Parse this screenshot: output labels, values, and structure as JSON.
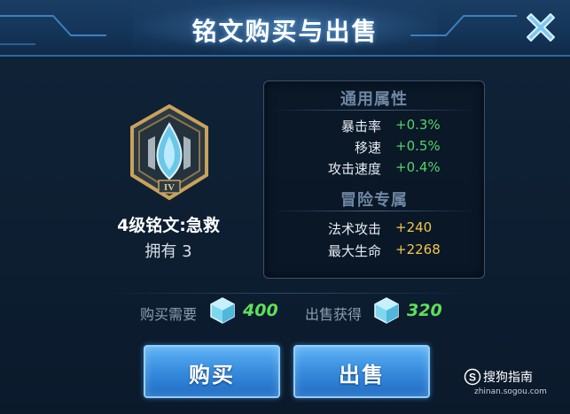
{
  "header": {
    "title": "铭文购买与出售"
  },
  "rune": {
    "name": "4级铭文:急救",
    "owned": "拥有 3",
    "tier_numeral": "IV"
  },
  "general_attrs": {
    "title": "通用属性",
    "rows": [
      {
        "label": "暴击率",
        "value": "+0.3%"
      },
      {
        "label": "移速",
        "value": "+0.5%"
      },
      {
        "label": "攻击速度",
        "value": "+0.4%"
      }
    ]
  },
  "adventure_attrs": {
    "title": "冒险专属",
    "rows": [
      {
        "label": "法术攻击",
        "value": "+240"
      },
      {
        "label": "最大生命",
        "value": "+2268"
      }
    ]
  },
  "purchase": {
    "label": "购买需要",
    "amount": "400"
  },
  "sale": {
    "label": "出售获得",
    "amount": "320"
  },
  "buttons": {
    "buy": "购买",
    "sell": "出售"
  },
  "watermark": {
    "brand": "搜狗指南",
    "url": "zhinan.sogou.com"
  },
  "colors": {
    "positive_green": "#55d46a",
    "gold": "#f1c64b",
    "price_green": "#5fe05a",
    "button_blue": "#3a8fe0"
  },
  "icons": {
    "close": "close-x-icon",
    "currency": "crystal-icon",
    "rune": "rune-emblem-icon"
  }
}
